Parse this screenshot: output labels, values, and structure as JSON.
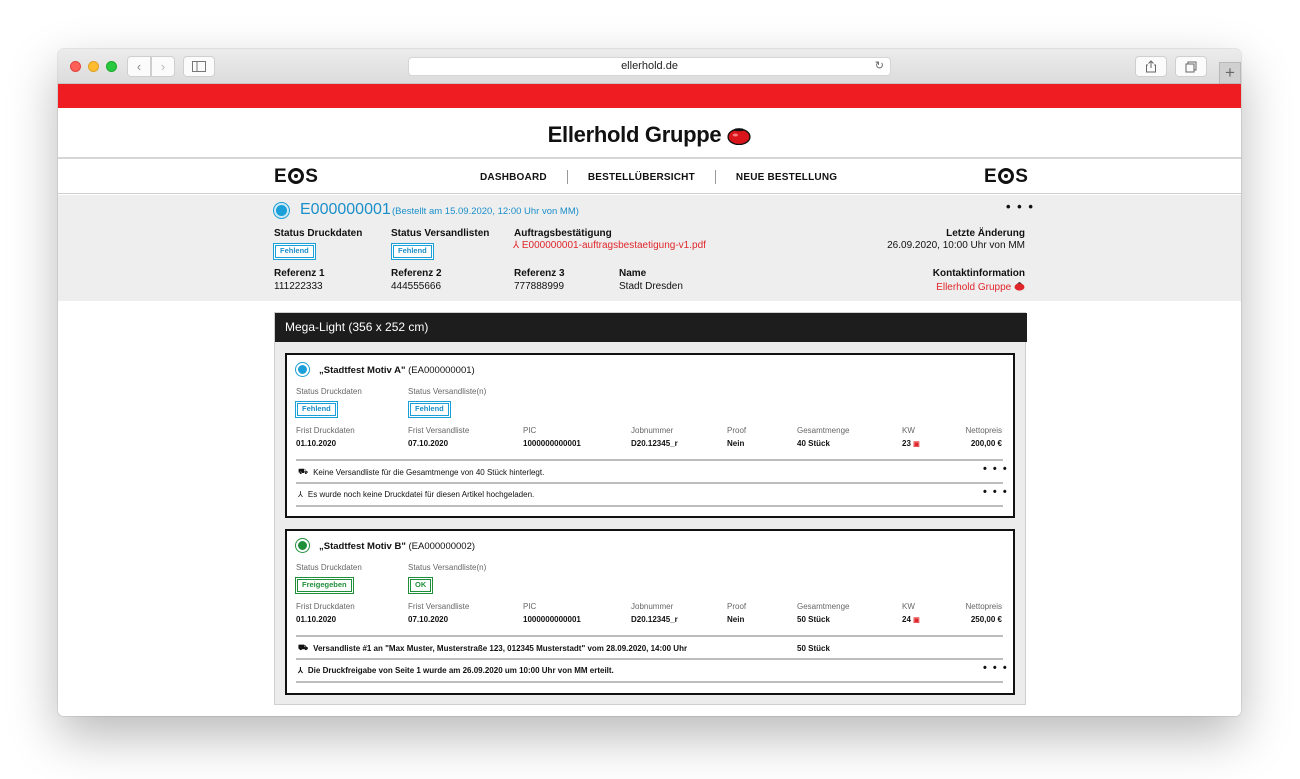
{
  "browser": {
    "address": "ellerhold.de"
  },
  "brand": {
    "name": "Ellerhold Gruppe",
    "logo_left": "EOS",
    "logo_right": "EOS"
  },
  "nav": {
    "items": [
      "DASHBOARD",
      "BESTELLÜBERSICHT",
      "NEUE BESTELLUNG"
    ]
  },
  "order": {
    "id": "E000000001",
    "subtitle": "(Bestellt am 15.09.2020, 12:00 Uhr von MM)",
    "menu": "• • •",
    "status_druckdaten_label": "Status Druckdaten",
    "status_druckdaten": "Fehlend",
    "status_versandlisten_label": "Status Versandlisten",
    "status_versandlisten": "Fehlend",
    "auftrag_label": "Auftragsbestätigung",
    "auftrag_file": "E000000001-auftragsbestaetigung-v1.pdf",
    "letzte_label": "Letzte Änderung",
    "letzte_value": "26.09.2020, 10:00 Uhr von MM",
    "ref1_label": "Referenz 1",
    "ref1": "111222333",
    "ref2_label": "Referenz 2",
    "ref2": "444555666",
    "ref3_label": "Referenz 3",
    "ref3": "777888999",
    "name_label": "Name",
    "name": "Stadt Dresden",
    "kontakt_label": "Kontaktinformation",
    "kontakt": "Ellerhold Gruppe"
  },
  "section": {
    "title": "Mega-Light (356 x 252 cm)"
  },
  "labels": {
    "status_druckdaten": "Status Druckdaten",
    "status_versandliste": "Status Versandliste(n)",
    "frist_druckdaten": "Frist Druckdaten",
    "frist_versandliste": "Frist Versandliste",
    "pic": "PIC",
    "jobnummer": "Jobnummer",
    "proof": "Proof",
    "gesamtmenge": "Gesamtmenge",
    "kw": "KW",
    "nettopreis": "Nettopreis"
  },
  "items": [
    {
      "title": "„Stadtfest Motiv A\"",
      "code": "(EA000000001)",
      "status_druckdaten": "Fehlend",
      "status_versandliste": "Fehlend",
      "frist_druckdaten": "01.10.2020",
      "frist_versandliste": "07.10.2020",
      "pic": "1000000000001",
      "jobnummer": "D20.12345_r",
      "proof": "Nein",
      "gesamtmenge": "40 Stück",
      "kw": "23",
      "nettopreis": "200,00 €",
      "note1": "Keine Versandliste für die Gesamtmenge von 40 Stück hinterlegt.",
      "note2": "Es wurde noch keine Druckdatei für diesen Artikel hochgeladen."
    },
    {
      "title": "„Stadtfest Motiv B\"",
      "code": "(EA000000002)",
      "status_druckdaten": "Freigegeben",
      "status_versandliste": "OK",
      "frist_druckdaten": "01.10.2020",
      "frist_versandliste": "07.10.2020",
      "pic": "1000000000001",
      "jobnummer": "D20.12345_r",
      "proof": "Nein",
      "gesamtmenge": "50 Stück",
      "kw": "24",
      "nettopreis": "250,00 €",
      "note1": "Versandliste #1 an \"Max Muster, Musterstraße 123, 012345 Musterstadt\" vom 28.09.2020, 14:00 Uhr",
      "note1_qty": "50 Stück",
      "note2": "Die Druckfreigabe von Seite 1 wurde am 26.09.2020 um 10:00 Uhr von MM erteilt."
    }
  ],
  "colors": {
    "brand_red": "#ef1c22",
    "status_blue": "#1a9fd8",
    "status_green": "#1f8f3a",
    "section_header": "#1d1d1d"
  },
  "icons": [
    "truck-icon",
    "pdf-icon",
    "calendar-icon",
    "tomato-logo-icon",
    "share-icon",
    "tabs-icon",
    "reload-icon"
  ]
}
